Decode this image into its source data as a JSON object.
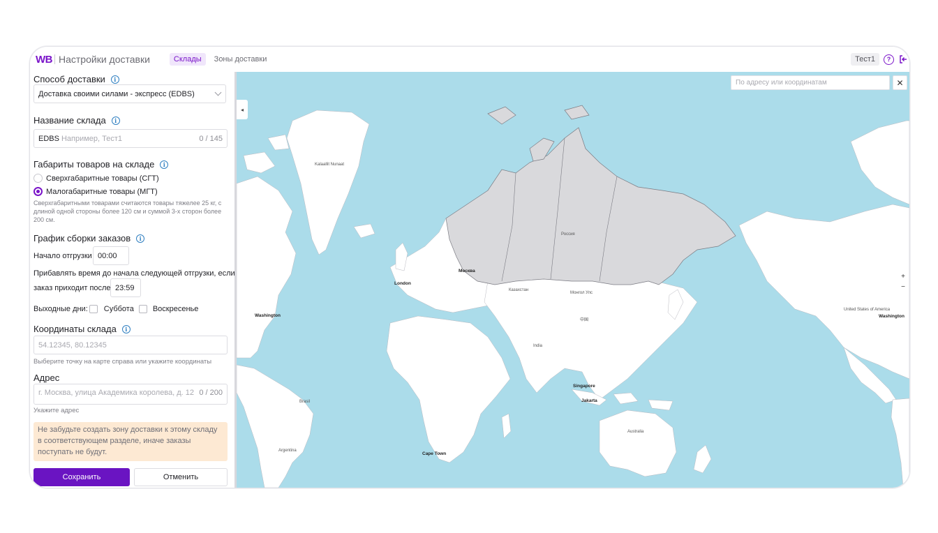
{
  "header": {
    "logo": "WB",
    "title": "Настройки доставки",
    "tabs": [
      {
        "label": "Склады",
        "active": true
      },
      {
        "label": "Зоны доставки",
        "active": false
      }
    ],
    "user": "Тест1",
    "help_icon": "question-circle-icon",
    "logout_icon": "logout-icon",
    "accent_color": "#7a14c9"
  },
  "form": {
    "delivery_method": {
      "title": "Способ доставки",
      "value": "Доставка своими силами - экспресс (EDBS)"
    },
    "warehouse_name": {
      "title": "Название склада",
      "prefix": "EDBS",
      "placeholder": "Например, Тест1",
      "counter": "0 / 145"
    },
    "dimensions": {
      "title": "Габариты товаров на складе",
      "options": [
        {
          "label": "Сверхгабаритные товары (СГТ)",
          "checked": false
        },
        {
          "label": "Малогабаритные товары (МГТ)",
          "checked": true
        }
      ],
      "hint": "Сверхгабаритными товарами считаются товары тяжелее 25 кг, с длиной одной стороны более 120 см и суммой 3-х сторон более 200 см."
    },
    "schedule": {
      "title": "График сборки заказов",
      "start_label": "Начало отгрузки с",
      "start_value": "00:00",
      "add_time_label_1": "Прибавлять время до начала следующей отгрузки, если",
      "add_time_label_2": "заказ приходит после",
      "add_time_value": "23:59",
      "weekends_label": "Выходные дни:",
      "saturday": "Суббота",
      "sunday": "Воскресенье"
    },
    "coordinates": {
      "title": "Координаты склада",
      "placeholder": "54.12345, 80.12345",
      "hint": "Выберите точку на карте справа или укажите координаты"
    },
    "address": {
      "title": "Адрес",
      "placeholder": "г. Москва, улица Академика королева, д. 12",
      "counter": "0 / 200",
      "hint": "Укажите адрес"
    },
    "warning": "Не забудьте создать зону доставки к этому складу в соответствующем разделе, иначе заказы поступать не будут.",
    "save_label": "Сохранить",
    "cancel_label": "Отменить"
  },
  "map": {
    "search_placeholder": "По адресу или координатам",
    "collapse": "◂",
    "zoom_in": "+",
    "zoom_out": "−",
    "water_color": "#abdcea",
    "land_color": "#ffffff",
    "highlight_color": "#d9d9dc",
    "labels": {
      "washington": "Washington",
      "washington2": "Washington",
      "london": "London",
      "moscow": "Москва",
      "singapore": "Singapore",
      "jakarta": "Jakarta",
      "cape_town": "Cape Town",
      "australia": "Australia",
      "india": "India",
      "china": "中国",
      "kazakhstan": "Казахстан",
      "mongolia": "Монгол Улс",
      "brazil": "Brasil",
      "argentina": "Argentina",
      "usa": "United States of America",
      "greenland": "Kalaallit Nunaat",
      "russia": "Россия"
    }
  }
}
